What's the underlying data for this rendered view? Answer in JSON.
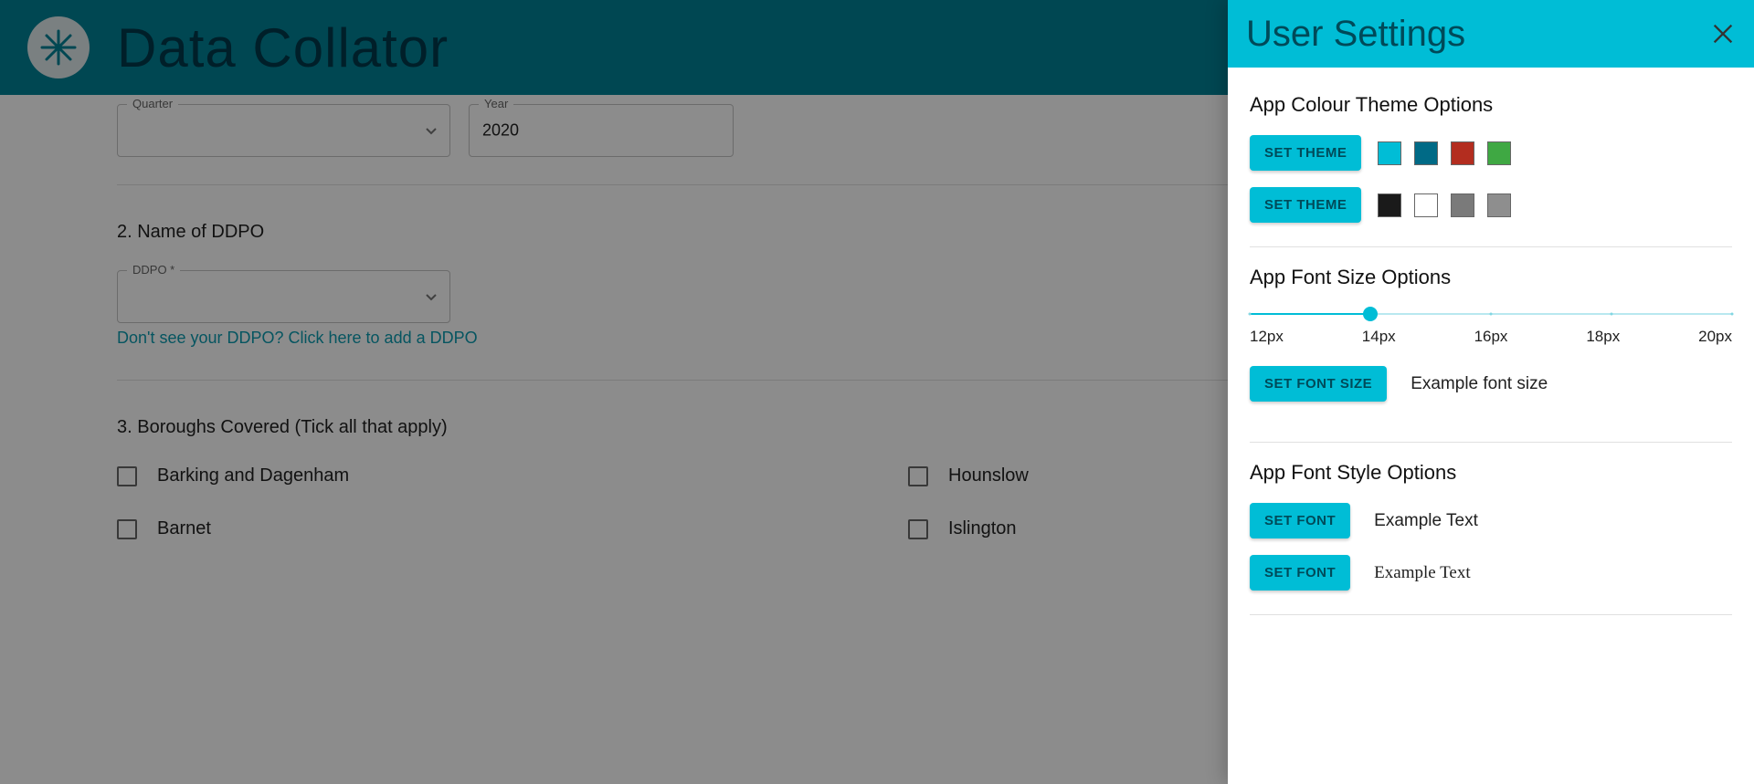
{
  "header": {
    "app_title": "Data Collator"
  },
  "form": {
    "quarter": {
      "label": "Quarter",
      "value": ""
    },
    "year": {
      "label": "Year",
      "value": "2020"
    },
    "ddpo_section_title": "2. Name of DDPO",
    "ddpo": {
      "label": "DDPO *",
      "value": ""
    },
    "ddpo_link": "Don't see your DDPO? Click here to add a DDPO",
    "boroughs_title": "3. Boroughs Covered (Tick all that apply)",
    "boroughs_col1": [
      "Barking and Dagenham",
      "Barnet"
    ],
    "boroughs_col2": [
      "Hounslow",
      "Islington"
    ]
  },
  "drawer": {
    "title": "User Settings",
    "theme_heading": "App Colour Theme Options",
    "set_theme_label": "SET THEME",
    "theme_row1_colors": [
      "#00bdd6",
      "#006a86",
      "#b32d1f",
      "#3fa843"
    ],
    "theme_row2_colors": [
      "#1a1a1a",
      "#ffffff",
      "#7a7a7a",
      "#8e8e8e"
    ],
    "fontsize_heading": "App Font Size Options",
    "slider_marks": [
      "12px",
      "14px",
      "16px",
      "18px",
      "20px"
    ],
    "slider_value_index": 1,
    "set_fontsize_label": "SET FONT SIZE",
    "fontsize_example": "Example font size",
    "fontstyle_heading": "App Font Style Options",
    "set_font_label": "SET FONT",
    "fontstyle_example": "Example Text"
  }
}
